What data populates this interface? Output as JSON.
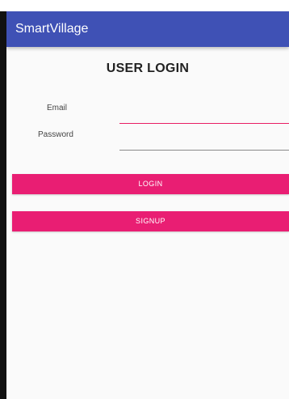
{
  "app_bar": {
    "title": "SmartVillage"
  },
  "login": {
    "heading": "USER LOGIN",
    "email_label": "Email",
    "email_value": "",
    "password_label": "Password",
    "password_value": "",
    "login_button": "LOGIN",
    "signup_button": "SIGNUP"
  },
  "colors": {
    "app_bar": "#3f51b5",
    "button": "#e91e73",
    "email_underline": "#e91e63",
    "password_underline": "#8a8a8a"
  }
}
